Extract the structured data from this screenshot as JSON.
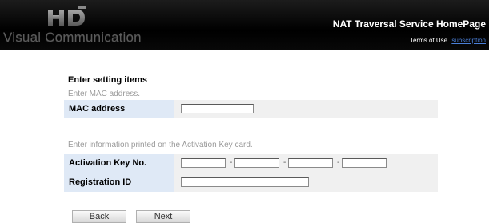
{
  "header": {
    "logo_text": "Visual Communication",
    "site_title": "NAT Traversal Service HomePage",
    "terms_label": "Terms of Use",
    "subscription_label": "subscription"
  },
  "form": {
    "section_title": "Enter setting items",
    "mac_hint": "Enter MAC address.",
    "mac_label": "MAC address",
    "mac_value": "",
    "activation_hint": "Enter information printed on the Activation Key card.",
    "activation_label": "Activation Key No.",
    "activation_values": [
      "",
      "",
      "",
      ""
    ],
    "activation_separator": "-",
    "registration_label": "Registration ID",
    "registration_value": ""
  },
  "buttons": {
    "back": "Back",
    "next": "Next"
  },
  "colors": {
    "header_bg": "#000000",
    "label_bg": "#dfe9f6",
    "field_bg": "#f0f0f0",
    "link": "#4a7fd8"
  }
}
